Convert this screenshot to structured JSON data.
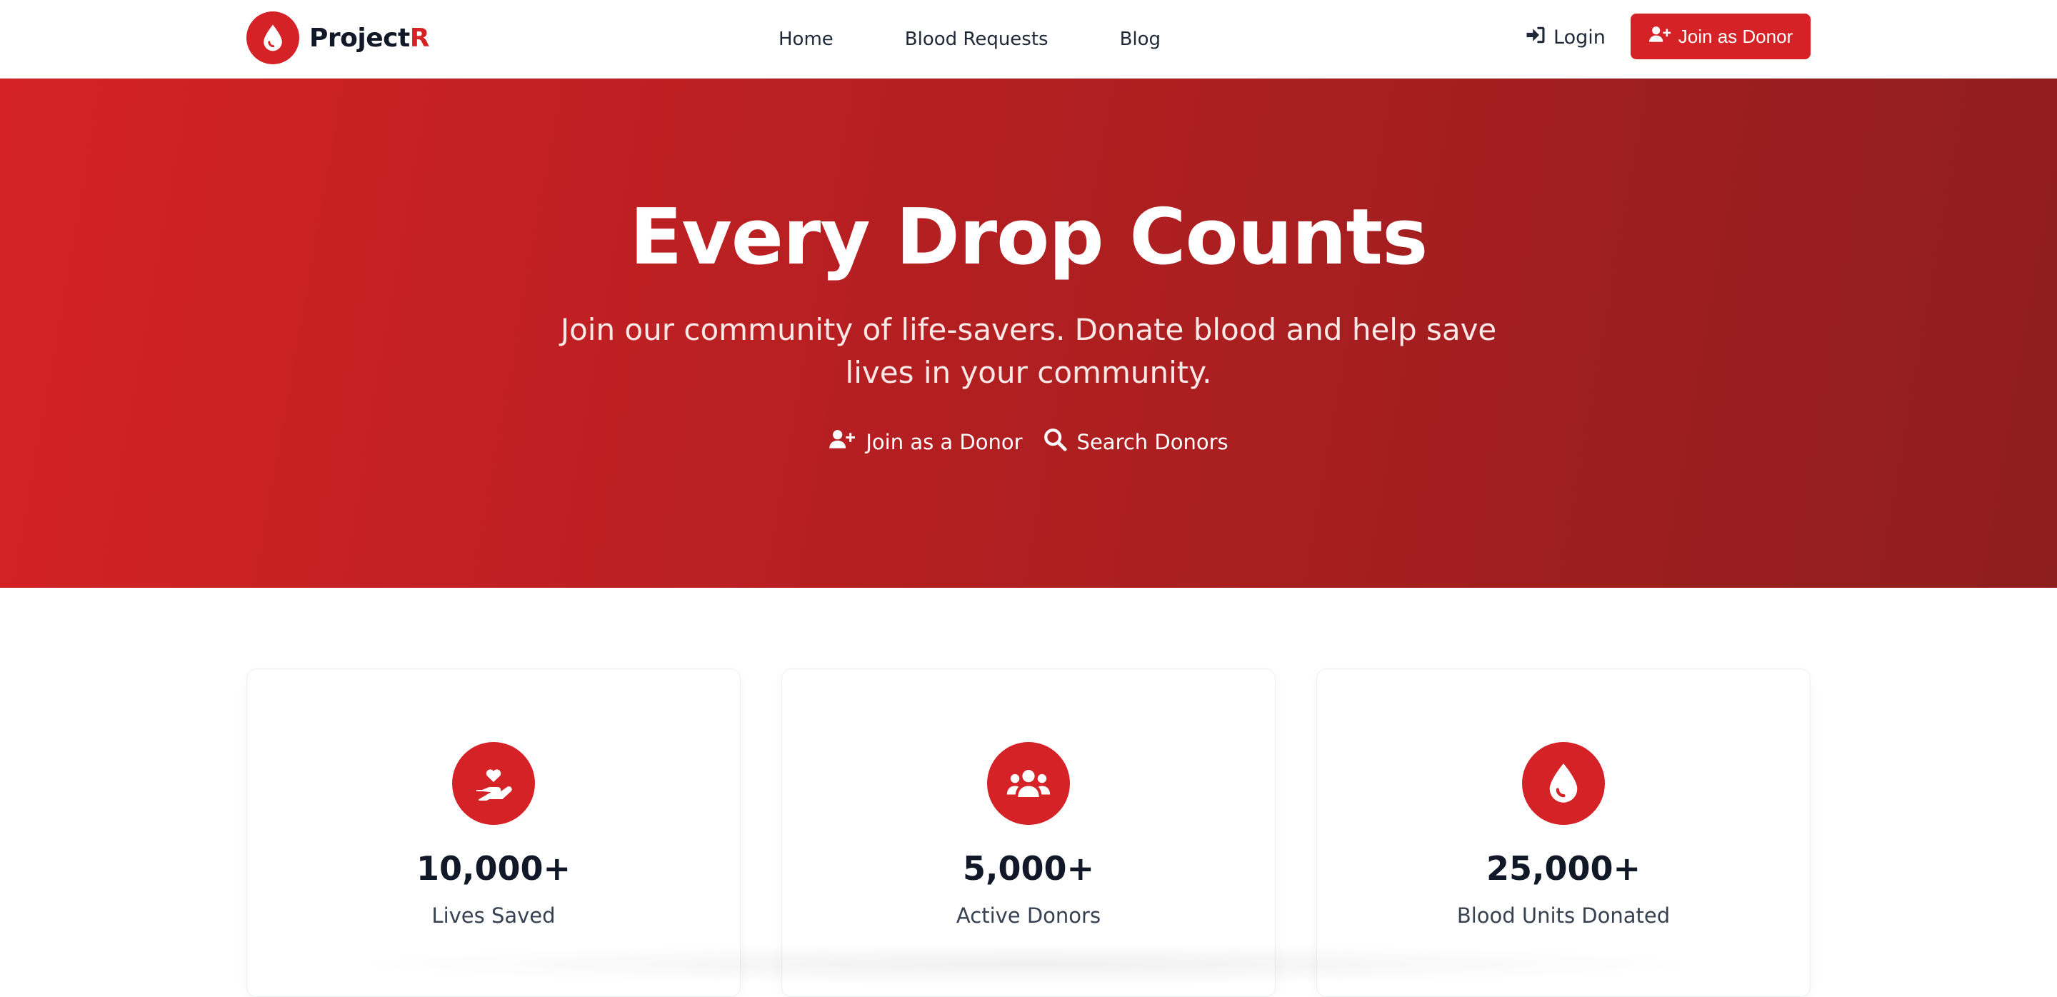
{
  "brand": {
    "name_main": "Project",
    "name_accent": "R",
    "logo_icon": "blood-drop-icon"
  },
  "nav": {
    "items": [
      {
        "label": "Home"
      },
      {
        "label": "Blood Requests"
      },
      {
        "label": "Blog"
      }
    ]
  },
  "header": {
    "login_label": "Login",
    "login_icon": "sign-in-icon",
    "join_label": "Join as Donor",
    "join_icon": "user-plus-icon"
  },
  "hero": {
    "title": "Every Drop Counts",
    "subtitle": "Join our community of life-savers. Donate blood and help save lives in your community.",
    "actions": [
      {
        "label": "Join as a Donor",
        "icon": "user-plus-icon"
      },
      {
        "label": "Search Donors",
        "icon": "search-icon"
      }
    ]
  },
  "stats": [
    {
      "value": "10,000+",
      "label": "Lives Saved",
      "icon": "hand-heart-icon"
    },
    {
      "value": "5,000+",
      "label": "Active Donors",
      "icon": "users-icon"
    },
    {
      "value": "25,000+",
      "label": "Blood Units Donated",
      "icon": "blood-drop-icon"
    }
  ],
  "colors": {
    "brand_red": "#d42226",
    "hero_gradient_start": "#d42226",
    "hero_gradient_end": "#8f1e1e",
    "text_dark": "#111827"
  }
}
